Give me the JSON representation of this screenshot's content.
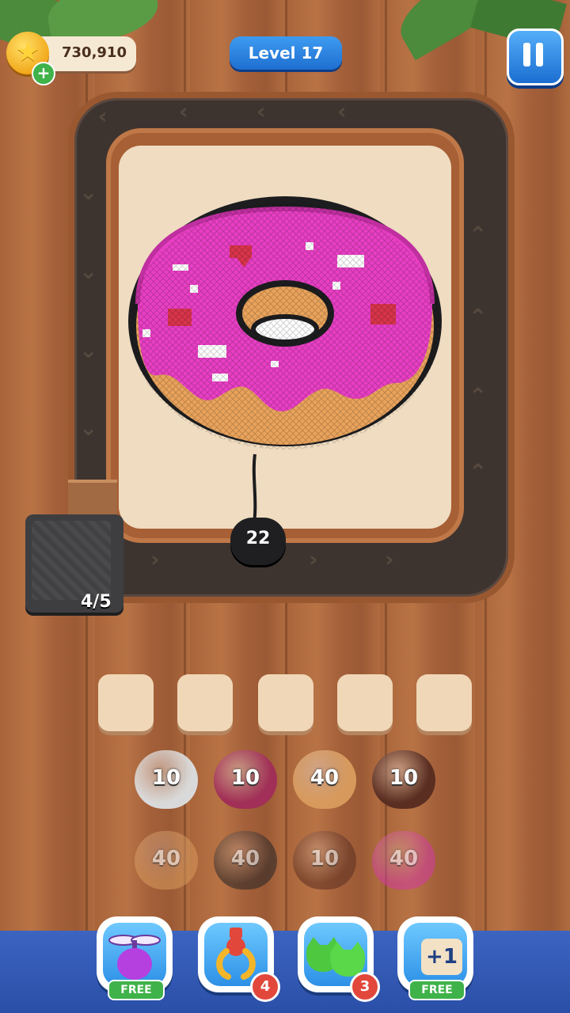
{
  "header": {
    "coins": "730,910",
    "level_label": "Level 17"
  },
  "board": {
    "artwork": "donut",
    "shooter_count": "22",
    "spool_counter": "4/5"
  },
  "slots": 5,
  "yarn_rows": [
    [
      {
        "value": "10",
        "color": "#d9d9d9",
        "active": true
      },
      {
        "value": "10",
        "color": "#a12f57",
        "active": true
      },
      {
        "value": "40",
        "color": "#d89a5c",
        "active": true
      },
      {
        "value": "10",
        "color": "#5a2e21",
        "active": true
      }
    ],
    [
      {
        "value": "40",
        "color": "#d89a5c",
        "active": false
      },
      {
        "value": "40",
        "color": "#232326",
        "active": false
      },
      {
        "value": "10",
        "color": "#5a2e21",
        "active": false
      },
      {
        "value": "40",
        "color": "#d239a3",
        "active": false
      }
    ]
  ],
  "boosters": [
    {
      "name": "propeller",
      "badge_type": "free",
      "badge": "FREE"
    },
    {
      "name": "claw",
      "badge_type": "count",
      "badge": "4"
    },
    {
      "name": "cats",
      "badge_type": "count",
      "badge": "3"
    },
    {
      "name": "extra-slot",
      "label": "+1",
      "badge_type": "free",
      "badge": "FREE"
    }
  ]
}
